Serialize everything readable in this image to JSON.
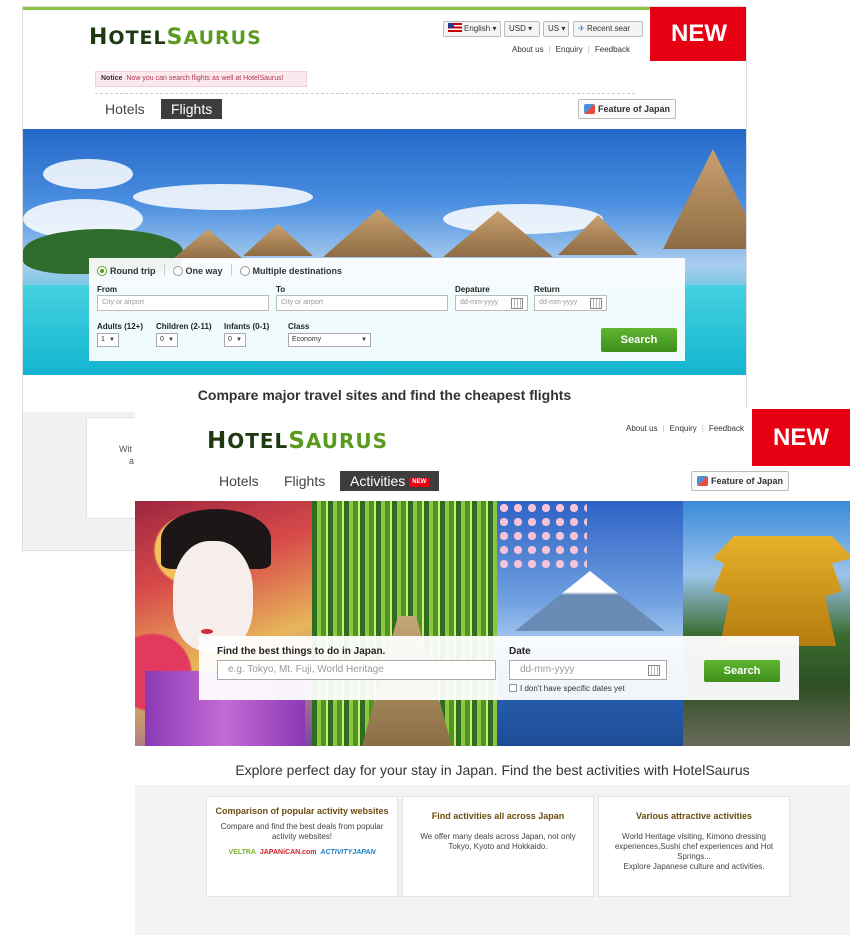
{
  "screen1": {
    "logo": {
      "first": "H",
      "a": "OTEL",
      "second": "S",
      "b": "AURUS"
    },
    "language": "English ▾",
    "currency": "USD ▾",
    "country": "US ▾",
    "recent": "Recent sear",
    "links": [
      "About us",
      "Enquiry",
      "Feedback"
    ],
    "badge": "NEW",
    "notice": {
      "label": "Notice",
      "text": "Now you can search flights as well at HotelSaurus!"
    },
    "tabs": [
      "Hotels",
      "Flights"
    ],
    "feature": "Feature of Japan",
    "trip_options": [
      "Round trip",
      "One way",
      "Multiple destinations"
    ],
    "from": {
      "label": "From",
      "placeholder": "City or airport"
    },
    "to": {
      "label": "To",
      "placeholder": "City or airport"
    },
    "depart": {
      "label": "Depature",
      "placeholder": "dd-mm-yyyy"
    },
    "return": {
      "label": "Return",
      "placeholder": "dd-mm-yyyy"
    },
    "adults": {
      "label": "Adults (12+)",
      "value": "1"
    },
    "children": {
      "label": "Children (2-11)",
      "value": "0"
    },
    "infants": {
      "label": "Infants (0-1)",
      "value": "0"
    },
    "class": {
      "label": "Class",
      "value": "Economy"
    },
    "search": "Search",
    "heading": "Compare major travel sites and find the cheapest flights",
    "card_text": [
      "Wit",
      "a"
    ]
  },
  "screen2": {
    "logo": {
      "first": "H",
      "a": "OTEL",
      "second": "S",
      "b": "AURUS"
    },
    "links": [
      "About us",
      "Enquiry",
      "Feedback"
    ],
    "badge": "NEW",
    "tabs": [
      "Hotels",
      "Flights",
      "Activities"
    ],
    "tab_badge": "NEW",
    "feature": "Feature of Japan",
    "find": {
      "label": "Find the best things to do in Japan.",
      "placeholder": "e.g. Tokyo, Mt. Fuji, World Heritage"
    },
    "date": {
      "label": "Date",
      "placeholder": "dd-mm-yyyy"
    },
    "no_date": "I don't have specific dates yet",
    "search": "Search",
    "heading": "Explore perfect day for your stay in Japan. Find the best activities with HotelSaurus",
    "cards": [
      {
        "title": "Comparison of popular activity websites",
        "desc": "Compare and find the best deals from popular activity websites!",
        "logos": [
          "VELTRA",
          "JAPANiCAN.com",
          "ACTIVITYJAPAN"
        ]
      },
      {
        "title": "Find activities all across Japan",
        "desc": "We offer many deals across Japan, not only Tokyo, Kyoto and Hokkaido."
      },
      {
        "title": "Various attractive activities",
        "desc": "World Heritage visiting, Kimono dressing experiences,Sushi chef experiences and Hot Springs...",
        "desc2": "Explore Japanese culture and activities."
      }
    ]
  },
  "colors": {
    "brand_green": "#5a9b1f",
    "new_red": "#e60012",
    "search_green": "#4aa326"
  }
}
